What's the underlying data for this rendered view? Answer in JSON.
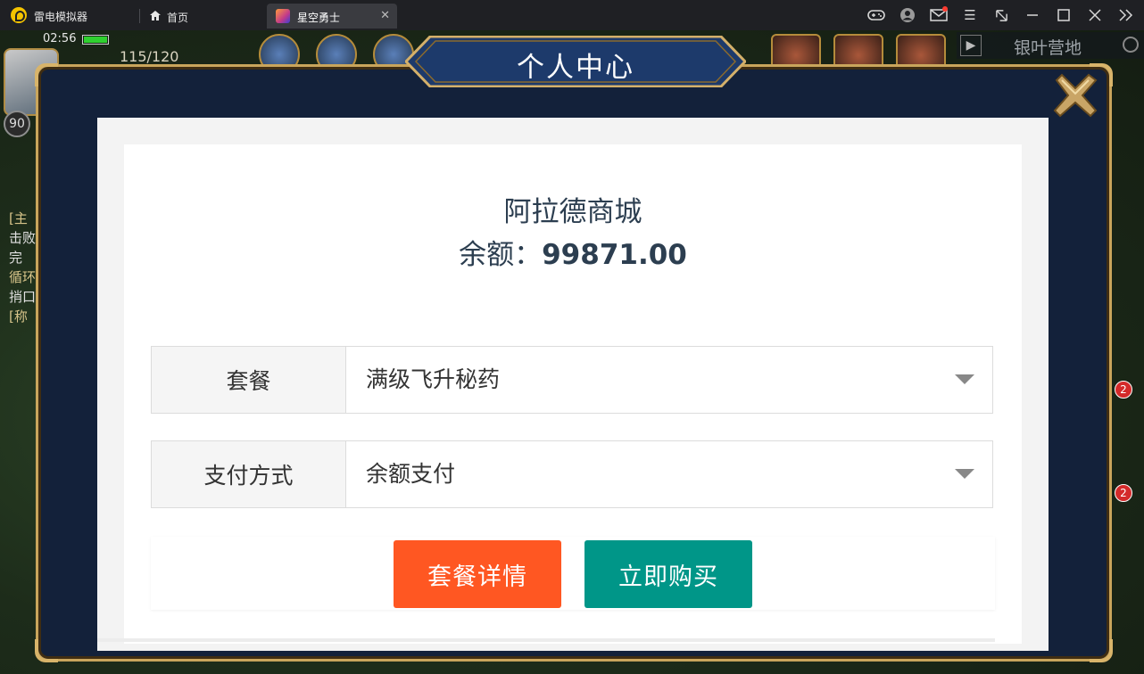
{
  "window": {
    "app_name": "雷电模拟器",
    "tabs": [
      {
        "label": "首页",
        "icon": "home-icon"
      },
      {
        "label": "星空勇士",
        "icon": "game-icon",
        "active": true
      }
    ],
    "controls": [
      "gamepad-icon",
      "account-icon",
      "mail-icon",
      "menu-icon",
      "resize-icon",
      "minimize-icon",
      "maximize-icon",
      "close-icon",
      "collapse-icon"
    ]
  },
  "hud": {
    "time": "02:56",
    "stamina": "115/120",
    "level": "90",
    "location": "银叶营地",
    "notification_counts": [
      "2",
      "2"
    ],
    "side_text": [
      "[主",
      "击败",
      "完",
      "循环",
      "捎口",
      "[称"
    ]
  },
  "modal": {
    "title": "个人中心"
  },
  "shop": {
    "name": "阿拉德商城",
    "balance_label": "余额：",
    "balance_value": "99871.00",
    "package": {
      "label": "套餐",
      "selected": "满级飞升秘药"
    },
    "payment": {
      "label": "支付方式",
      "selected": "余额支付"
    },
    "buttons": {
      "detail": "套餐详情",
      "buy": "立即购买"
    },
    "colors": {
      "detail": "#ff5722",
      "buy": "#009688",
      "text": "#2c3e50"
    }
  }
}
